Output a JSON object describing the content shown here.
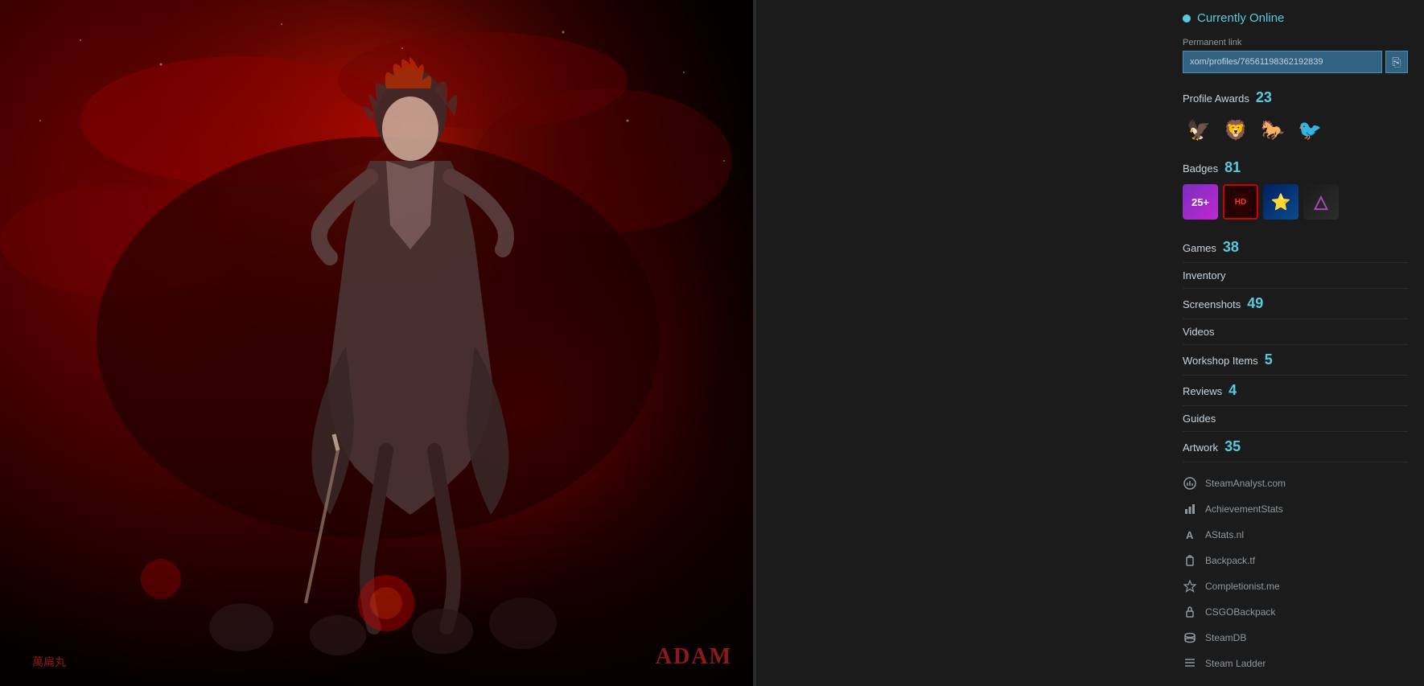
{
  "status": {
    "label": "Currently Online",
    "color": "#57cbde"
  },
  "permanent_link": {
    "label": "Permanent link",
    "value": "xom/profiles/76561198362192839",
    "full_url": "https://steamcommunity.com/profiles/76561198362192839"
  },
  "profile_awards": {
    "label": "Profile Awards",
    "count": 23,
    "icons": [
      "🦅",
      "🦁",
      "🐎",
      "🐦"
    ]
  },
  "badges": {
    "label": "Badges",
    "count": 81,
    "items": [
      {
        "id": "badge-25plus",
        "display": "25+"
      },
      {
        "id": "badge-hd",
        "display": "HD"
      },
      {
        "id": "badge-star",
        "display": "✦"
      },
      {
        "id": "badge-triangle",
        "display": "△"
      }
    ]
  },
  "nav_items": [
    {
      "id": "games",
      "label": "Games",
      "count": "38",
      "has_count": true
    },
    {
      "id": "inventory",
      "label": "Inventory",
      "count": "",
      "has_count": false
    },
    {
      "id": "screenshots",
      "label": "Screenshots",
      "count": "49",
      "has_count": true
    },
    {
      "id": "videos",
      "label": "Videos",
      "count": "",
      "has_count": false
    },
    {
      "id": "workshop-items",
      "label": "Workshop Items",
      "count": "5",
      "has_count": true
    },
    {
      "id": "reviews",
      "label": "Reviews",
      "count": "4",
      "has_count": true
    },
    {
      "id": "guides",
      "label": "Guides",
      "count": "",
      "has_count": false
    },
    {
      "id": "artwork",
      "label": "Artwork",
      "count": "35",
      "has_count": true
    }
  ],
  "ext_links": [
    {
      "id": "steam-analyst",
      "label": "SteamAnalyst.com",
      "icon": "chart"
    },
    {
      "id": "achievement-stats",
      "label": "AchievementStats",
      "icon": "bar"
    },
    {
      "id": "astats",
      "label": "AStats.nl",
      "icon": "a"
    },
    {
      "id": "backpack-tf",
      "label": "Backpack.tf",
      "icon": "pack"
    },
    {
      "id": "completionist",
      "label": "Completionist.me",
      "icon": "medal"
    },
    {
      "id": "csgo-backpack",
      "label": "CSGOBackpack",
      "icon": "lock"
    },
    {
      "id": "steamdb",
      "label": "SteamDB",
      "icon": "db"
    },
    {
      "id": "steam-ladder",
      "label": "Steam Ladder",
      "icon": "list"
    }
  ],
  "watermark": {
    "name": "ADAM",
    "kanji": "萬扁丸"
  }
}
